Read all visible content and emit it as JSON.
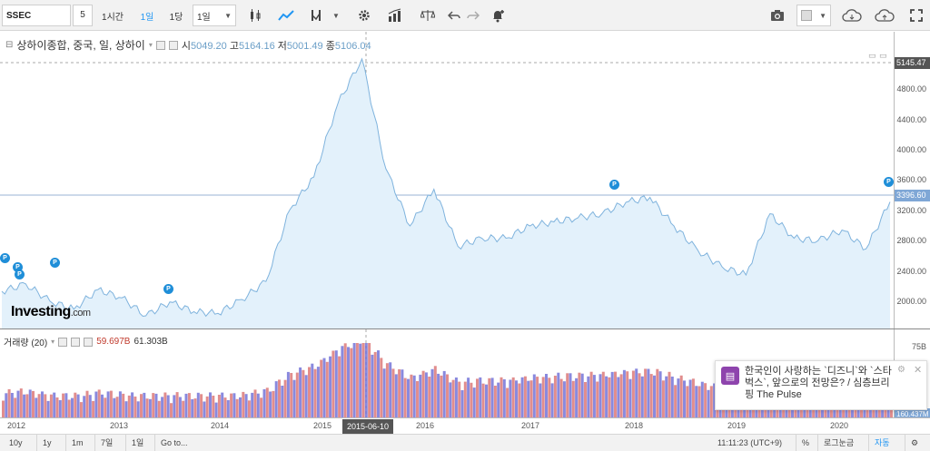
{
  "toolbar": {
    "symbol": "SSEC",
    "resolution": "5",
    "btn_1h": "1시간",
    "btn_1d": "1일",
    "btn_1day": "1당",
    "btn_1w": "1일"
  },
  "legend": {
    "title": "상하이종합, 중국, 일, 상하이",
    "open_label": "시",
    "open": "5049.20",
    "high_label": "고",
    "high": "5164.16",
    "low_label": "저",
    "low": "5001.49",
    "close_label": "종",
    "close": "5106.04"
  },
  "volume_legend": {
    "title": "거래량 (20)",
    "v1": "59.697B",
    "v2": "61.303B"
  },
  "brand": {
    "name": "Investing",
    "suffix": ".com"
  },
  "price_axis": {
    "ticks": [
      "4800.00",
      "4400.00",
      "4000.00",
      "3600.00",
      "3200.00",
      "2800.00",
      "2400.00",
      "2000.00"
    ],
    "crosshair_price": "5145.47",
    "last_price": "3396.60"
  },
  "volume_axis": {
    "top": "75B",
    "last": "160.437M"
  },
  "time_axis": {
    "labels": [
      "2012",
      "2013",
      "2014",
      "2015",
      "2016",
      "2017",
      "2018",
      "2019",
      "2020"
    ],
    "crosshair_date": "2015-06-10"
  },
  "bottombar": {
    "ranges": [
      "10y",
      "1y",
      "1m",
      "7일",
      "1일"
    ],
    "goto": "Go to...",
    "time": "11:11:23 (UTC+9)",
    "pct": "%",
    "log": "로그눈금",
    "auto": "자동"
  },
  "notification": {
    "text": "한국인이 사랑하는 `디즈니`와 `스타벅스`, 앞으로의 전망은? / 심층브리핑 The Pulse"
  },
  "pin_label": "P",
  "colors": {
    "line": "#7fb3dd",
    "area": "#e3f1fb",
    "accent": "#2196f3",
    "vol_up": "#6b6bd6",
    "vol_down": "#d97070"
  },
  "chart_data": {
    "type": "area",
    "x": [
      "2012-01",
      "2012-04",
      "2012-07",
      "2012-10",
      "2013-01",
      "2013-04",
      "2013-07",
      "2013-10",
      "2014-01",
      "2014-04",
      "2014-07",
      "2014-10",
      "2015-01",
      "2015-03",
      "2015-05",
      "2015-06",
      "2015-07",
      "2015-09",
      "2015-12",
      "2016-01",
      "2016-04",
      "2016-07",
      "2016-10",
      "2017-01",
      "2017-04",
      "2017-07",
      "2017-10",
      "2018-01",
      "2018-04",
      "2018-07",
      "2018-10",
      "2019-01",
      "2019-04",
      "2019-07",
      "2019-10",
      "2020-01",
      "2020-04",
      "2020-07"
    ],
    "y": [
      2300,
      2390,
      2180,
      2080,
      2320,
      2220,
      2000,
      2170,
      2050,
      2030,
      2200,
      2420,
      3300,
      3700,
      4600,
      5145,
      3800,
      3100,
      3550,
      2850,
      2950,
      2950,
      3100,
      3150,
      3200,
      3250,
      3390,
      3450,
      3100,
      2800,
      2600,
      2500,
      3250,
      2950,
      2920,
      3050,
      2820,
      3396
    ],
    "ylim": [
      1900,
      5200
    ]
  }
}
